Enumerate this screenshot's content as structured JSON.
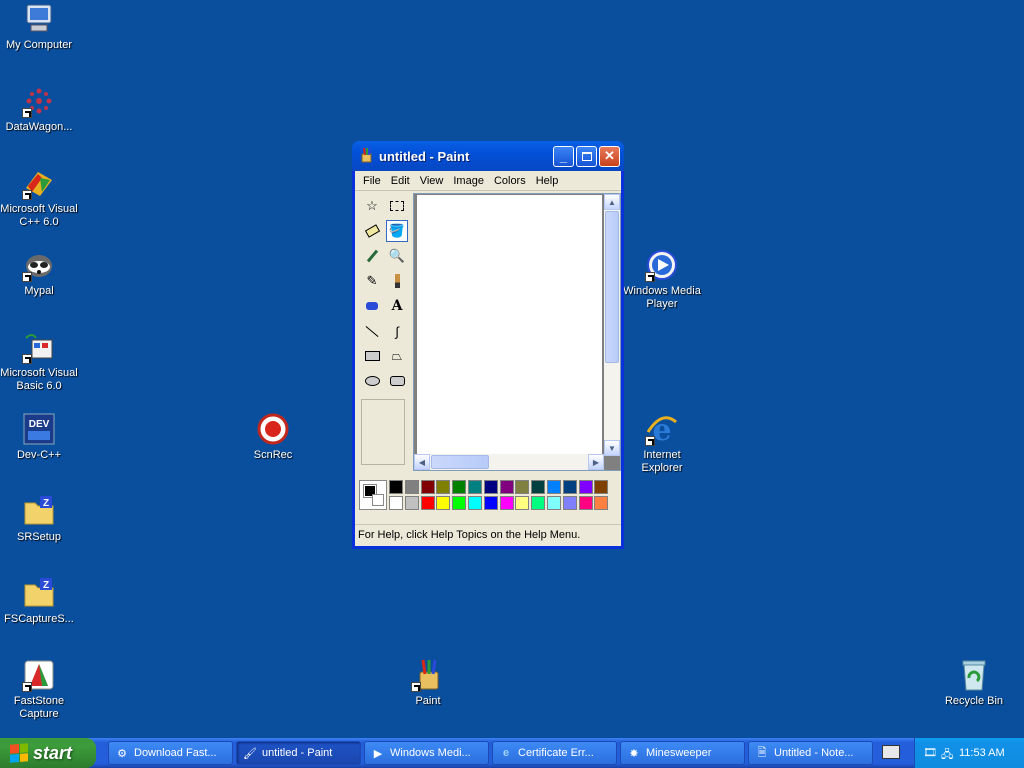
{
  "desktop": {
    "icons": [
      {
        "label": "My Computer"
      },
      {
        "label": "DataWagon..."
      },
      {
        "label": "Microsoft Visual C++ 6.0"
      },
      {
        "label": "Mypal"
      },
      {
        "label": "Microsoft Visual Basic 6.0"
      },
      {
        "label": "Dev-C++"
      },
      {
        "label": "SRSetup"
      },
      {
        "label": "FSCaptureS..."
      },
      {
        "label": "FastStone Capture"
      },
      {
        "label": "ScnRec"
      },
      {
        "label": "Paint"
      },
      {
        "label": "Windows Media Player"
      },
      {
        "label": "Internet Explorer"
      },
      {
        "label": "Recycle Bin"
      }
    ],
    "background_color": "#0a4f9e"
  },
  "paint": {
    "title": "untitled - Paint",
    "menu": [
      "File",
      "Edit",
      "View",
      "Image",
      "Colors",
      "Help"
    ],
    "status": "For Help, click Help Topics on the Help Menu.",
    "tools": [
      "free-select",
      "rect-select",
      "eraser",
      "fill",
      "color-picker",
      "magnifier",
      "pencil",
      "brush",
      "airbrush",
      "text",
      "line",
      "curve",
      "rectangle",
      "polygon",
      "ellipse",
      "rounded-rectangle"
    ],
    "selected_tool": "fill",
    "palette_top": [
      "#000000",
      "#808080",
      "#800000",
      "#808000",
      "#008000",
      "#008080",
      "#000080",
      "#800080",
      "#808040",
      "#004040",
      "#0080ff",
      "#004080",
      "#8000ff",
      "#804000"
    ],
    "palette_bottom": [
      "#ffffff",
      "#c0c0c0",
      "#ff0000",
      "#ffff00",
      "#00ff00",
      "#00ffff",
      "#0000ff",
      "#ff00ff",
      "#ffff80",
      "#00ff80",
      "#80ffff",
      "#8080ff",
      "#ff0080",
      "#ff8040"
    ]
  },
  "taskbar": {
    "start_label": "start",
    "tasks": [
      {
        "label": "Download Fast..."
      },
      {
        "label": "untitled - Paint"
      },
      {
        "label": "Windows Medi..."
      },
      {
        "label": "Certificate Err..."
      },
      {
        "label": "Minesweeper"
      },
      {
        "label": "Untitled - Note..."
      }
    ],
    "clock": "11:53 AM"
  }
}
